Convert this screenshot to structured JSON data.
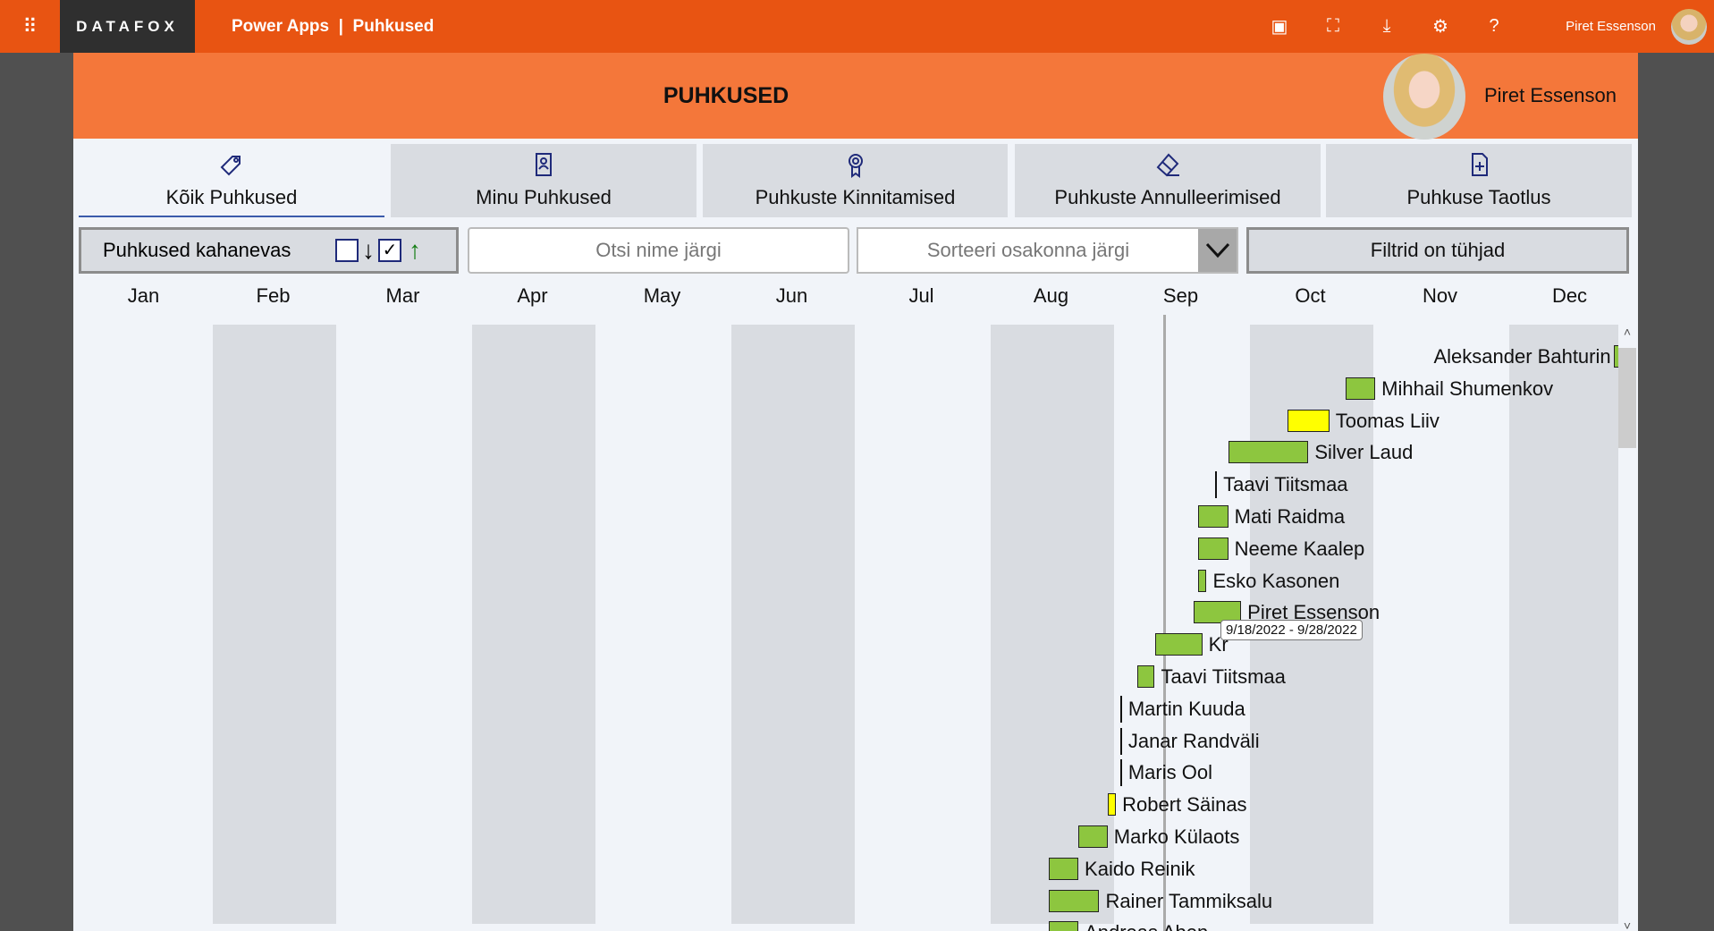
{
  "topbar": {
    "app_name": "Power Apps",
    "separator": "|",
    "page_name": "Puhkused",
    "logo_text": "DATAFOX",
    "user_name": "Piret Essenson",
    "icons": [
      "teams-icon",
      "fullscreen-icon",
      "download-icon",
      "settings-icon",
      "help-icon"
    ]
  },
  "header": {
    "title": "PUHKUSED",
    "user_name": "Piret Essenson"
  },
  "tabs": [
    {
      "label": "Kõik Puhkused",
      "icon": "tag-icon",
      "active": true
    },
    {
      "label": "Minu Puhkused",
      "icon": "contact-book-icon"
    },
    {
      "label": "Puhkuste Kinnitamised",
      "icon": "ribbon-icon"
    },
    {
      "label": "Puhkuste Annulleerimised",
      "icon": "eraser-icon"
    },
    {
      "label": "Puhkuse Taotlus",
      "icon": "new-document-icon"
    }
  ],
  "filters": {
    "sort_label": "Puhkused kahanevas",
    "sort_desc_checked": false,
    "sort_asc_checked": true,
    "search_placeholder": "Otsi nime järgi",
    "dept_placeholder": "Sorteeri osakonna järgi",
    "clear_label": "Filtrid on tühjad"
  },
  "colors": {
    "approved": "#8DC63F",
    "pending": "#FFFF00",
    "topbar": "#E85412",
    "header": "#F4773A"
  },
  "chart_data": {
    "type": "gantt",
    "year": 2022,
    "months": [
      "Jan",
      "Feb",
      "Mar",
      "Apr",
      "May",
      "Jun",
      "Jul",
      "Aug",
      "Sep",
      "Oct",
      "Nov",
      "Dec"
    ],
    "today": "2022-09-12",
    "tooltip": "9/18/2022 - 9/28/2022",
    "rows": [
      {
        "name": "Aleksander Bahturin",
        "start": "2022-12-27",
        "end": "2022-12-28",
        "status": "approved"
      },
      {
        "name": "Mihhail Shumenkov",
        "start": "2022-10-25",
        "end": "2022-10-31",
        "status": "approved"
      },
      {
        "name": "Toomas Liiv",
        "start": "2022-10-11",
        "end": "2022-10-20",
        "status": "pending"
      },
      {
        "name": "Silver Laud",
        "start": "2022-09-27",
        "end": "2022-10-15",
        "status": "approved"
      },
      {
        "name": "Taavi Tiitsmaa",
        "start": "2022-09-24",
        "end": "2022-09-24",
        "status": "none"
      },
      {
        "name": "Mati Raidma",
        "start": "2022-09-20",
        "end": "2022-09-26",
        "status": "approved"
      },
      {
        "name": "Neeme Kaalep",
        "start": "2022-09-20",
        "end": "2022-09-26",
        "status": "approved"
      },
      {
        "name": "Esko Kasonen",
        "start": "2022-09-20",
        "end": "2022-09-21",
        "status": "approved"
      },
      {
        "name": "Piret Essenson",
        "start": "2022-09-19",
        "end": "2022-09-29",
        "status": "approved"
      },
      {
        "name": "Kr",
        "start": "2022-09-10",
        "end": "2022-09-20",
        "status": "approved"
      },
      {
        "name": "Taavi Tiitsmaa",
        "start": "2022-09-06",
        "end": "2022-09-09",
        "status": "approved"
      },
      {
        "name": "Martin Kuuda",
        "start": "2022-09-02",
        "end": "2022-09-02",
        "status": "none"
      },
      {
        "name": "Janar Randväli",
        "start": "2022-09-02",
        "end": "2022-09-02",
        "status": "none"
      },
      {
        "name": "Maris Ool",
        "start": "2022-09-02",
        "end": "2022-09-02",
        "status": "none"
      },
      {
        "name": "Robert Säinas",
        "start": "2022-08-30",
        "end": "2022-08-31",
        "status": "pending"
      },
      {
        "name": "Marko Külaots",
        "start": "2022-08-23",
        "end": "2022-08-29",
        "status": "approved"
      },
      {
        "name": "Kaido Reinik",
        "start": "2022-08-16",
        "end": "2022-08-22",
        "status": "approved"
      },
      {
        "name": "Rainer Tammiksalu",
        "start": "2022-08-16",
        "end": "2022-08-27",
        "status": "approved"
      },
      {
        "name": "Andreas Aben",
        "start": "2022-08-16",
        "end": "2022-08-22",
        "status": "approved"
      }
    ]
  }
}
